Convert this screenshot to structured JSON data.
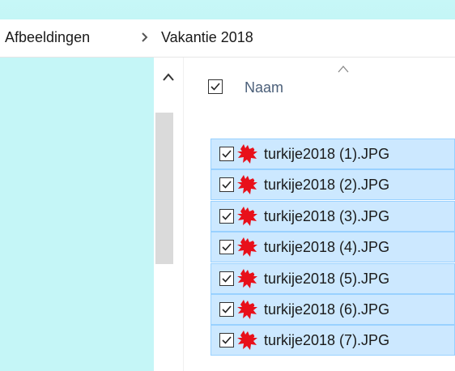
{
  "breadcrumb": {
    "items": [
      "Afbeeldingen",
      "Vakantie 2018"
    ]
  },
  "column_header": {
    "label": "Naam",
    "checked": true
  },
  "files": [
    {
      "name": "turkije2018 (1).JPG",
      "checked": true,
      "selected": true
    },
    {
      "name": "turkije2018 (2).JPG",
      "checked": true,
      "selected": true
    },
    {
      "name": "turkije2018 (3).JPG",
      "checked": true,
      "selected": true
    },
    {
      "name": "turkije2018 (4).JPG",
      "checked": true,
      "selected": true
    },
    {
      "name": "turkije2018 (5).JPG",
      "checked": true,
      "selected": true
    },
    {
      "name": "turkije2018 (6).JPG",
      "checked": true,
      "selected": true
    },
    {
      "name": "turkije2018 (7).JPG",
      "checked": true,
      "selected": true
    }
  ],
  "icons": {
    "breadcrumb_separator": "chevron-right-icon",
    "file_type": "jpg-image-icon",
    "sort": "sort-ascending-icon",
    "scroll_up": "scroll-up-icon"
  },
  "colors": {
    "selection_fill": "#cce8ff",
    "selection_border": "#99d1ff",
    "nav_background": "#c5f6f7",
    "header_text": "#4c607a",
    "file_icon": "#e8101a"
  }
}
